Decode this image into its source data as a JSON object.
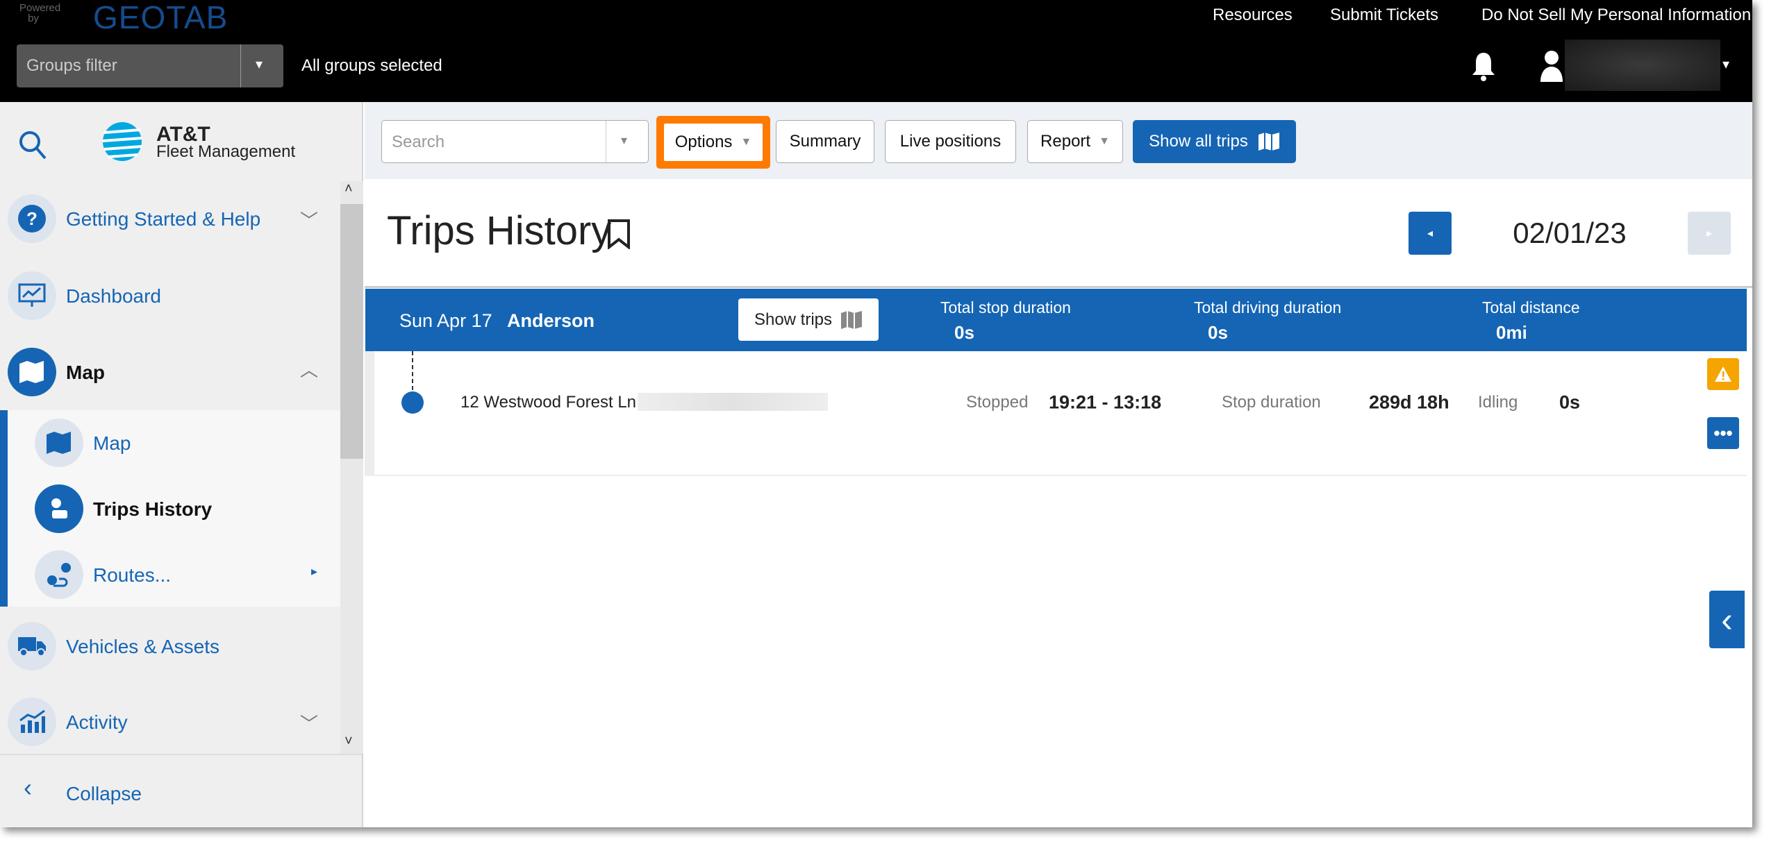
{
  "topbar": {
    "powered_by": "Powered by",
    "brand": "GEOTAB",
    "links": [
      "Resources",
      "Submit Tickets",
      "Do Not Sell My Personal Information"
    ],
    "groups_filter_placeholder": "Groups filter",
    "groups_status": "All groups selected"
  },
  "sidebar": {
    "logo_line1": "AT&T",
    "logo_line2": "Fleet Management",
    "items": [
      {
        "label": "Getting Started & Help",
        "icon": "question-icon"
      },
      {
        "label": "Dashboard",
        "icon": "dashboard-icon"
      },
      {
        "label": "Map",
        "icon": "map-icon"
      },
      {
        "label": "Map",
        "icon": "map-icon"
      },
      {
        "label": "Trips History",
        "icon": "trips-icon"
      },
      {
        "label": "Routes...",
        "icon": "route-icon"
      },
      {
        "label": "Vehicles & Assets",
        "icon": "truck-icon"
      },
      {
        "label": "Activity",
        "icon": "activity-icon"
      }
    ],
    "collapse": "Collapse"
  },
  "toolbar": {
    "search_placeholder": "Search",
    "options": "Options",
    "summary": "Summary",
    "live_positions": "Live positions",
    "report": "Report",
    "show_all_trips": "Show all trips",
    "highlight_color": "#ff7a00"
  },
  "header": {
    "title": "Trips History",
    "date": "02/01/23"
  },
  "group": {
    "date": "Sun Apr 17",
    "driver": "Anderson",
    "show_trips": "Show trips",
    "stats": [
      {
        "label": "Total stop duration",
        "value": "0s"
      },
      {
        "label": "Total driving duration",
        "value": "0s"
      },
      {
        "label": "Total distance",
        "value": "0mi"
      }
    ]
  },
  "row": {
    "address": "12 Westwood Forest Ln,",
    "status": "Stopped",
    "time": "19:21 - 13:18",
    "stop_duration_label": "Stop duration",
    "stop_duration": "289d 18h",
    "idling_label": "Idling",
    "idling": "0s"
  },
  "colors": {
    "primary": "#1565b4",
    "warning": "#f5a400"
  }
}
